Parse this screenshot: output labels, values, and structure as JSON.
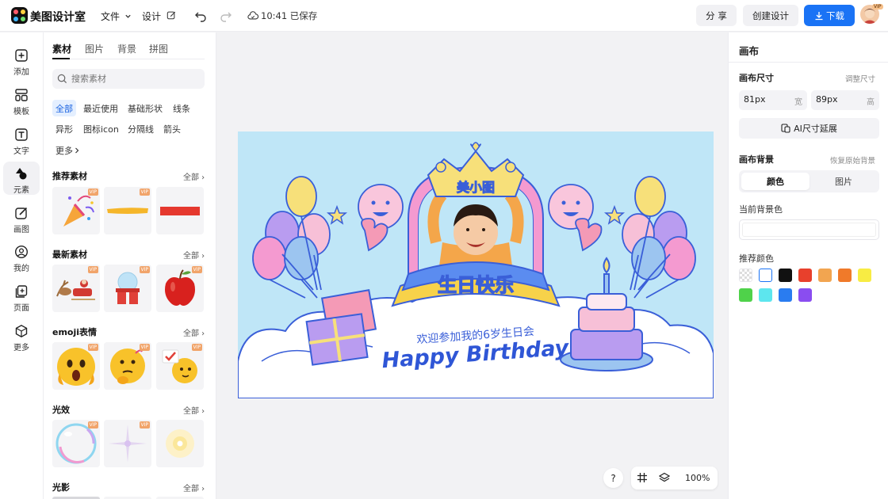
{
  "header": {
    "app_name": "美图设计室",
    "menu_file": "文件",
    "menu_design": "设计",
    "save_status": "10:41 已保存",
    "share_label": "分 享",
    "create_label": "创建设计",
    "download_label": "下载",
    "avatar_badge": "VIP",
    "colors": {
      "accent": "#1a73f5"
    }
  },
  "rail": {
    "items": [
      {
        "label": "添加",
        "icon": "plus-square-icon"
      },
      {
        "label": "模板",
        "icon": "layout-icon"
      },
      {
        "label": "文字",
        "icon": "text-icon"
      },
      {
        "label": "元素",
        "icon": "shapes-icon",
        "active": true
      },
      {
        "label": "画图",
        "icon": "edit-icon"
      },
      {
        "label": "我的",
        "icon": "user-icon"
      },
      {
        "label": "页面",
        "icon": "add-page-icon"
      },
      {
        "label": "更多",
        "icon": "cube-icon"
      }
    ]
  },
  "materials": {
    "tabs": [
      "素材",
      "图片",
      "背景",
      "拼图"
    ],
    "search_placeholder": "搜索素材",
    "chips": [
      "全部",
      "最近使用",
      "基础形状",
      "线条",
      "异形",
      "图标icon",
      "分隔线",
      "箭头",
      "更多"
    ],
    "vip": "VIP",
    "all_label": "全部",
    "sections": [
      {
        "title": "推荐素材",
        "tiles": [
          "party-popper",
          "yellow-brush-stroke",
          "red-rectangle"
        ]
      },
      {
        "title": "最新素材",
        "tiles": [
          "santa-sleigh",
          "snow-globe-gift",
          "red-apple"
        ]
      },
      {
        "title": "emoji表情",
        "tiles": [
          "shocked-emoji",
          "thinking-emoji",
          "saluting-emoji"
        ]
      },
      {
        "title": "光效",
        "tiles": [
          "bubble-ring",
          "sparkle-star",
          "soft-glow"
        ]
      },
      {
        "title": "光影",
        "tiles": []
      }
    ]
  },
  "canvas": {
    "poster": {
      "crown_text": "美小图",
      "banner_text": "生日快乐",
      "subtitle": "欢迎参加我的6岁生日会",
      "headline": "Happy Birthday"
    },
    "zoom": "100%",
    "help": "?"
  },
  "right_panel": {
    "title": "画布",
    "size_label": "画布尺寸",
    "size_link": "调整尺寸",
    "width_value": "81px",
    "width_unit": "宽",
    "height_value": "89px",
    "height_unit": "高",
    "ai_extend": "AI尺寸延展",
    "bg_label": "画布背景",
    "bg_reset": "恢复原始背景",
    "seg_color": "颜色",
    "seg_image": "图片",
    "current_bg_label": "当前背景色",
    "recommended_label": "推荐颜色",
    "swatches": [
      "transparent",
      "#ffffff",
      "#111111",
      "#e8402c",
      "#f2a550",
      "#f07a2a",
      "#f8ec43",
      "#4fd24a",
      "#5de6ee",
      "#2a7cf0",
      "#8a4df0"
    ]
  }
}
